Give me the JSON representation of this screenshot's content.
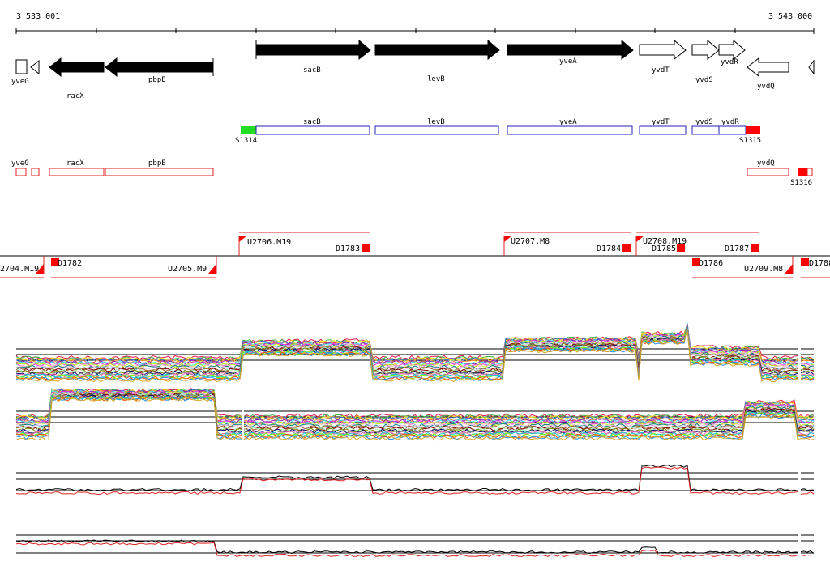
{
  "ruler": {
    "start_label": "3 533 001",
    "end_label": "3 543 000"
  },
  "colors": {
    "gene_fill": "#000000",
    "gene_outline": "#000000",
    "transcript_box": "#2222bb",
    "segment_box": "#dd2222",
    "start_marker": "#22dd22",
    "end_marker": "#ff0000",
    "background": "#ffffff"
  },
  "genes": [
    {
      "name": "yveG",
      "strand": "-",
      "filled": false
    },
    {
      "name": "racX",
      "strand": "-",
      "filled": true
    },
    {
      "name": "pbpE",
      "strand": "-",
      "filled": true
    },
    {
      "name": "sacB",
      "strand": "+",
      "filled": true
    },
    {
      "name": "levB",
      "strand": "+",
      "filled": true
    },
    {
      "name": "yveA",
      "strand": "+",
      "filled": true
    },
    {
      "name": "yvdT",
      "strand": "+",
      "filled": false
    },
    {
      "name": "yvdS",
      "strand": "+",
      "filled": false
    },
    {
      "name": "yvdR",
      "strand": "+",
      "filled": false
    },
    {
      "name": "yvdQ",
      "strand": "-",
      "filled": false
    }
  ],
  "transcript_plus": {
    "labels": [
      "sacB",
      "levB",
      "yveA",
      "yvdT",
      "yvdS",
      "yvdR"
    ],
    "start_marker": "S1314",
    "end_marker": "S1315"
  },
  "transcript_minus": {
    "labels": [
      "yveG",
      "racX",
      "pbpE",
      "yvdQ"
    ],
    "end_marker": "S1316"
  },
  "upper_segments": [
    {
      "start": "U2706.M19",
      "end": "D1783"
    },
    {
      "start": "U2707.M8",
      "end": "D1784"
    },
    {
      "start": "U2708.M19",
      "end": "D1787",
      "mid": "D1785"
    }
  ],
  "lower_segments": [
    {
      "label": "2704.M19"
    },
    {
      "label": "D1782"
    },
    {
      "label": "U2705.M9"
    },
    {
      "label": "D1786"
    },
    {
      "label": "U2709.M8"
    },
    {
      "label": "D1788"
    }
  ],
  "expression_panels": [
    {
      "name": "plus-strand-multi",
      "style": "multicolor"
    },
    {
      "name": "minus-strand-multi",
      "style": "multicolor"
    },
    {
      "name": "plus-strand-pair",
      "style": "pair"
    },
    {
      "name": "minus-strand-pair",
      "style": "pair"
    }
  ]
}
